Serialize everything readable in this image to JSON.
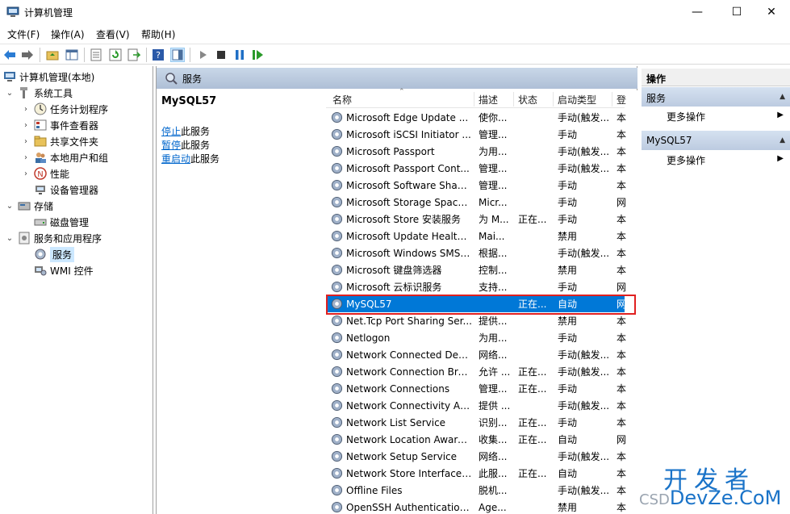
{
  "window": {
    "title": "计算机管理",
    "controls": {
      "minimize": "—",
      "maximize": "☐",
      "close": "✕"
    }
  },
  "menu": [
    "文件(F)",
    "操作(A)",
    "查看(V)",
    "帮助(H)"
  ],
  "tree": {
    "root": "计算机管理(本地)",
    "system_tools": "系统工具",
    "task_scheduler": "任务计划程序",
    "event_viewer": "事件查看器",
    "shared_folders": "共享文件夹",
    "local_users": "本地用户和组",
    "performance": "性能",
    "device_manager": "设备管理器",
    "storage": "存储",
    "disk_management": "磁盘管理",
    "services_apps": "服务和应用程序",
    "services": "服务",
    "wmi": "WMI 控件"
  },
  "services_panel": {
    "header": "服务",
    "selected_name": "MySQL57",
    "stop_link": "停止",
    "stop_rest": "此服务",
    "pause_link": "暂停",
    "pause_rest": "此服务",
    "restart_link": "重启动",
    "restart_rest": "此服务"
  },
  "columns": {
    "name": "名称",
    "desc": "描述",
    "status": "状态",
    "startup": "启动类型",
    "login": "登"
  },
  "services": [
    {
      "name": "Microsoft Edge Update ...",
      "desc": "使你...",
      "status": "",
      "startup": "手动(触发...",
      "login": "本"
    },
    {
      "name": "Microsoft iSCSI Initiator ...",
      "desc": "管理...",
      "status": "",
      "startup": "手动",
      "login": "本"
    },
    {
      "name": "Microsoft Passport",
      "desc": "为用...",
      "status": "",
      "startup": "手动(触发...",
      "login": "本"
    },
    {
      "name": "Microsoft Passport Cont...",
      "desc": "管理...",
      "status": "",
      "startup": "手动(触发...",
      "login": "本"
    },
    {
      "name": "Microsoft Software Shad...",
      "desc": "管理...",
      "status": "",
      "startup": "手动",
      "login": "本"
    },
    {
      "name": "Microsoft Storage Space...",
      "desc": "Micr...",
      "status": "",
      "startup": "手动",
      "login": "网"
    },
    {
      "name": "Microsoft Store 安装服务",
      "desc": "为 M...",
      "status": "正在...",
      "startup": "手动",
      "login": "本"
    },
    {
      "name": "Microsoft Update Health...",
      "desc": "Mai...",
      "status": "",
      "startup": "禁用",
      "login": "本"
    },
    {
      "name": "Microsoft Windows SMS ...",
      "desc": "根据...",
      "status": "",
      "startup": "手动(触发...",
      "login": "本"
    },
    {
      "name": "Microsoft 键盘筛选器",
      "desc": "控制...",
      "status": "",
      "startup": "禁用",
      "login": "本"
    },
    {
      "name": "Microsoft 云标识服务",
      "desc": "支持...",
      "status": "",
      "startup": "手动",
      "login": "网"
    },
    {
      "name": "MySQL57",
      "desc": "",
      "status": "正在...",
      "startup": "自动",
      "login": "网",
      "selected": true
    },
    {
      "name": "Net.Tcp Port Sharing Ser...",
      "desc": "提供...",
      "status": "",
      "startup": "禁用",
      "login": "本"
    },
    {
      "name": "Netlogon",
      "desc": "为用...",
      "status": "",
      "startup": "手动",
      "login": "本"
    },
    {
      "name": "Network Connected Devi...",
      "desc": "网络...",
      "status": "",
      "startup": "手动(触发...",
      "login": "本"
    },
    {
      "name": "Network Connection Bro...",
      "desc": "允许 ...",
      "status": "正在...",
      "startup": "手动(触发...",
      "login": "本"
    },
    {
      "name": "Network Connections",
      "desc": "管理...",
      "status": "正在...",
      "startup": "手动",
      "login": "本"
    },
    {
      "name": "Network Connectivity Ass...",
      "desc": "提供 ...",
      "status": "",
      "startup": "手动(触发...",
      "login": "本"
    },
    {
      "name": "Network List Service",
      "desc": "识别...",
      "status": "正在...",
      "startup": "手动",
      "login": "本"
    },
    {
      "name": "Network Location Aware...",
      "desc": "收集...",
      "status": "正在...",
      "startup": "自动",
      "login": "网"
    },
    {
      "name": "Network Setup Service",
      "desc": "网络...",
      "status": "",
      "startup": "手动(触发...",
      "login": "本"
    },
    {
      "name": "Network Store Interface ...",
      "desc": "此服...",
      "status": "正在...",
      "startup": "自动",
      "login": "本"
    },
    {
      "name": "Offline Files",
      "desc": "脱机...",
      "status": "",
      "startup": "手动(触发...",
      "login": "本"
    },
    {
      "name": "OpenSSH Authentication ...",
      "desc": "Age...",
      "status": "",
      "startup": "禁用",
      "login": "本"
    }
  ],
  "actions": {
    "title": "操作",
    "section1": "服务",
    "more1": "更多操作",
    "section2": "MySQL57",
    "more2": "更多操作"
  },
  "watermark": {
    "cn": "开发者",
    "prefix": "CSD",
    "domain": "DevZe.CoM"
  }
}
